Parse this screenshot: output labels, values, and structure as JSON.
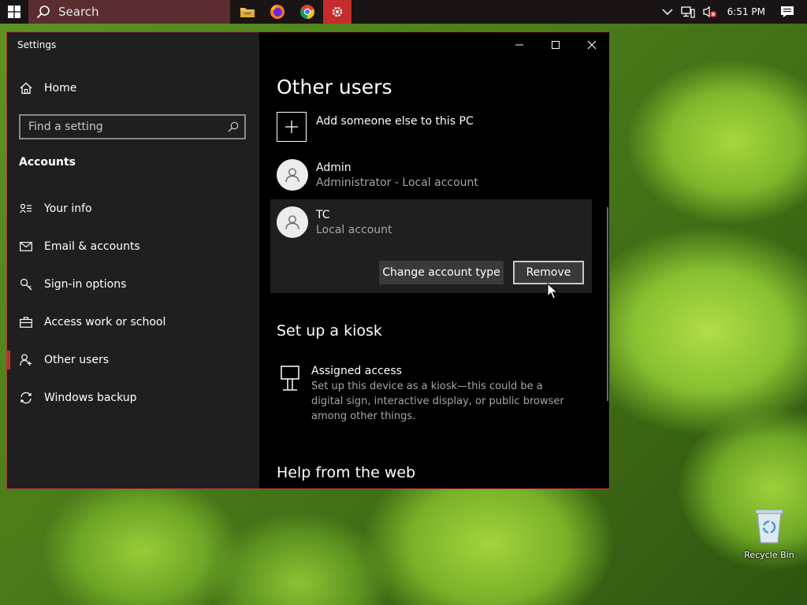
{
  "taskbar": {
    "search_label": "Search",
    "pinned": [
      {
        "name": "file-explorer-icon"
      },
      {
        "name": "firefox-icon"
      },
      {
        "name": "chrome-icon"
      },
      {
        "name": "settings-icon"
      }
    ],
    "clock": "6:51 PM"
  },
  "window": {
    "title": "Settings",
    "sidebar": {
      "home_label": "Home",
      "find_placeholder": "Find a setting",
      "section_title": "Accounts",
      "items": [
        {
          "label": "Your info",
          "icon": "contact-card-icon"
        },
        {
          "label": "Email & accounts",
          "icon": "mail-icon"
        },
        {
          "label": "Sign-in options",
          "icon": "key-icon"
        },
        {
          "label": "Access work or school",
          "icon": "briefcase-icon"
        },
        {
          "label": "Other users",
          "icon": "people-icon",
          "selected": true
        },
        {
          "label": "Windows backup",
          "icon": "sync-icon"
        }
      ]
    },
    "main": {
      "title": "Other users",
      "add_label": "Add someone else to this PC",
      "users": [
        {
          "name": "Admin",
          "type": "Administrator - Local account"
        },
        {
          "name": "TC",
          "type": "Local account"
        }
      ],
      "change_type_label": "Change account type",
      "remove_label": "Remove",
      "kiosk_heading": "Set up a kiosk",
      "kiosk_title": "Assigned access",
      "kiosk_desc": "Set up this device as a kiosk—this could be a digital sign, interactive display, or public browser among other things.",
      "help_heading": "Help from the web"
    }
  },
  "desktop": {
    "recycle_bin_label": "Recycle Bin"
  },
  "colors": {
    "accent": "#c22a2a",
    "search_bg": "#5b2d30"
  }
}
